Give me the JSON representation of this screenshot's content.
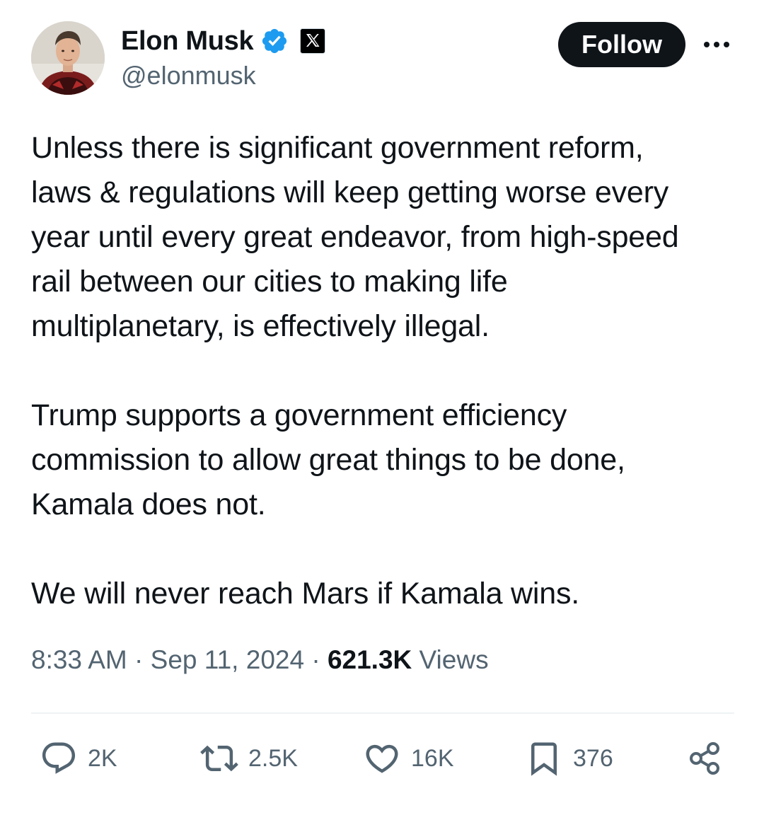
{
  "author": {
    "display_name": "Elon Musk",
    "handle": "@elonmusk",
    "verified_icon": "verified-badge-icon",
    "affiliate_icon": "x-logo-icon",
    "verified_color": "#1d9bf0"
  },
  "header": {
    "follow_label": "Follow",
    "more_icon": "more-horizontal-icon"
  },
  "tweet": {
    "paragraphs": [
      "Unless there is significant government reform,\nlaws & regulations will keep getting worse every\nyear until every great endeavor, from high-speed\nrail between our cities to making life\nmultiplanetary, is effectively illegal.",
      "Trump supports a government efficiency\ncommission to allow great things to be done,\nKamala does not.",
      "We will never reach Mars if Kamala wins."
    ]
  },
  "meta": {
    "time": "8:33 AM",
    "separator": "·",
    "date": "Sep 11, 2024",
    "views_count": "621.3K",
    "views_label": "Views"
  },
  "actions": {
    "replies": "2K",
    "reposts": "2.5K",
    "likes": "16K",
    "bookmarks": "376",
    "icons": [
      "reply-icon",
      "repost-icon",
      "like-icon",
      "bookmark-icon",
      "share-icon"
    ]
  },
  "colors": {
    "text": "#0f1419",
    "secondary": "#536471",
    "button_bg": "#0f1419",
    "divider": "#eff3f4"
  }
}
